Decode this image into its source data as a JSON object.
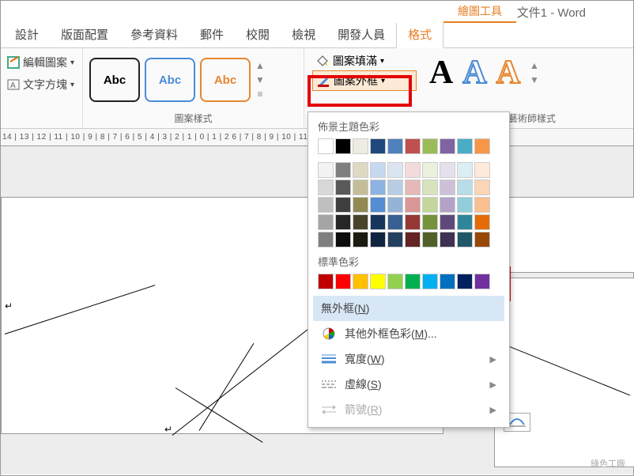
{
  "titlebar": {
    "context_tool": "繪圖工具",
    "title": "文件1 - Word"
  },
  "tabs": [
    "設計",
    "版面配置",
    "參考資料",
    "郵件",
    "校閱",
    "檢視",
    "開發人員",
    "格式"
  ],
  "active_tab": "格式",
  "ribbon": {
    "edit_shape": "編輯圖案",
    "text_box": "文字方塊",
    "shape_styles_label": "圖案樣式",
    "abc": "Abc",
    "shape_fill": "圖案填滿",
    "shape_outline": "圖案外框",
    "wordart_label": "文字藝術師樣式"
  },
  "ruler": "14  |  13  |  12  |  11  |  10  |  9  |  8  |  7  |  6  |  5  |  4  |  3  |  2  |  1  |  0  |  1  |  2                                                                                              6  |  7  |  8  |  9  |  10  |  11",
  "dropdown": {
    "theme_label": "佈景主題色彩",
    "standard_label": "標準色彩",
    "no_outline": "無外框(N)",
    "more_colors": "其他外框色彩(M)...",
    "width": "寬度(W)",
    "dashes": "虛線(S)",
    "arrows": "箭號(R)"
  },
  "theme_colors_row1": [
    "#ffffff",
    "#000000",
    "#eeece1",
    "#1f497d",
    "#4f81bd",
    "#c0504d",
    "#9bbb59",
    "#8064a2",
    "#4bacc6",
    "#f79646"
  ],
  "theme_shades": [
    [
      "#f2f2f2",
      "#7f7f7f",
      "#ddd9c3",
      "#c6d9f0",
      "#dbe5f1",
      "#f2dcdb",
      "#ebf1dd",
      "#e5e0ec",
      "#dbeef3",
      "#fdeada"
    ],
    [
      "#d8d8d8",
      "#595959",
      "#c4bd97",
      "#8db3e2",
      "#b8cce4",
      "#e5b9b7",
      "#d7e3bc",
      "#ccc1d9",
      "#b7dde8",
      "#fbd5b5"
    ],
    [
      "#bfbfbf",
      "#3f3f3f",
      "#938953",
      "#548dd4",
      "#95b3d7",
      "#d99694",
      "#c3d69b",
      "#b2a2c7",
      "#92cddc",
      "#fac08f"
    ],
    [
      "#a5a5a5",
      "#262626",
      "#494429",
      "#17365d",
      "#366092",
      "#953734",
      "#76923c",
      "#5f497a",
      "#31859b",
      "#e36c09"
    ],
    [
      "#7f7f7f",
      "#0c0c0c",
      "#1d1b10",
      "#0f243e",
      "#244061",
      "#632423",
      "#4f6128",
      "#3f3151",
      "#205867",
      "#974806"
    ]
  ],
  "standard_colors": [
    "#c00000",
    "#ff0000",
    "#ffc000",
    "#ffff00",
    "#92d050",
    "#00b050",
    "#00b0f0",
    "#0070c0",
    "#002060",
    "#7030a0"
  ],
  "watermark": "綠色工廠"
}
